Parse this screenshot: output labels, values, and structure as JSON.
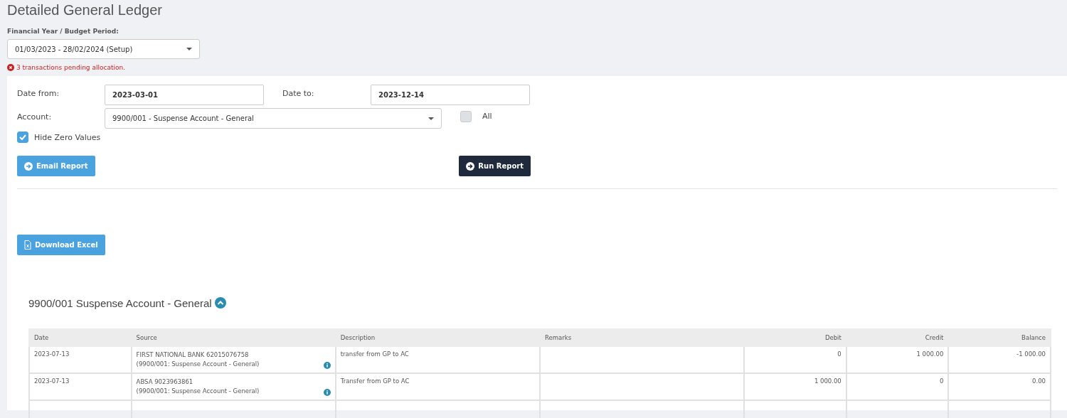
{
  "page_title": "Detailed General Ledger",
  "period": {
    "label": "Financial Year / Budget Period:",
    "value": "01/03/2023 - 28/02/2024 (Setup)"
  },
  "alert": "3 transactions pending allocation.",
  "filters": {
    "date_from": {
      "label": "Date from:",
      "value": "2023-03-01"
    },
    "date_to": {
      "label": "Date to:",
      "value": "2023-12-14"
    },
    "account": {
      "label": "Account:",
      "value": "9900/001 - Suspense Account - General"
    },
    "all": {
      "label": "All",
      "checked": false
    },
    "hide_zero": {
      "label": "Hide Zero Values",
      "checked": true
    }
  },
  "buttons": {
    "email": "Email Report",
    "run": "Run Report",
    "download": "Download Excel"
  },
  "section": {
    "title": "9900/001 Suspense Account - General",
    "expanded": true
  },
  "table": {
    "columns": [
      "Date",
      "Source",
      "Description",
      "Remarks",
      "Debit",
      "Credit",
      "Balance"
    ],
    "rows": [
      {
        "date": "2023-07-13",
        "source": "FIRST NATIONAL BANK 62015076758",
        "source_account": "(9900/001: Suspense Account - General)",
        "description": "transfer from GP to AC",
        "debit": "0",
        "credit": "1 000.00",
        "balance": "-1 000.00"
      },
      {
        "date": "2023-07-13",
        "source": "ABSA 9023963861",
        "source_account": "(9900/001: Suspense Account - General)",
        "description": "Transfer from GP to AC",
        "debit": "1 000.00",
        "credit": "0",
        "balance": "0.00"
      }
    ]
  }
}
